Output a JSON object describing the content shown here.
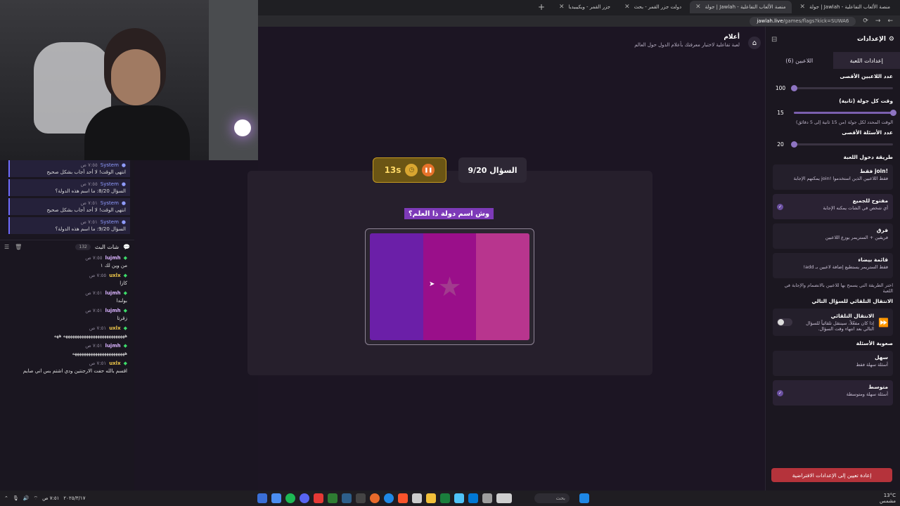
{
  "browser": {
    "tabs": [
      {
        "label": "جولة | Jawlah - منصة الألعاب التفاعلية",
        "active": false
      },
      {
        "label": "جولة | Jawlah - منصة الألعاب التفاعلية",
        "active": true
      },
      {
        "label": "دولت جزر القمر - بحث",
        "active": false
      },
      {
        "label": "جزر القمر - ويكيبيديا",
        "active": false
      }
    ],
    "url_domain": "jawlah.live",
    "url_path": "/games/flags?kick=SUWA6"
  },
  "chat": {
    "system_messages": [
      {
        "user": "System",
        "time": "٧:٥٥ ص",
        "text": "انتهى الوقت! لا أحد أجاب بشكل صحيح"
      },
      {
        "user": "System",
        "time": "٧:٥٥ ص",
        "text": "السؤال 8/20: ما اسم هذه الدولة؟"
      },
      {
        "user": "System",
        "time": "٧:٥١ ص",
        "text": "انتهى الوقت! لا أحد أجاب بشكل صحيح"
      },
      {
        "user": "System",
        "time": "٧:٥١ ص",
        "text": "السؤال 9/20: ما اسم هذه الدولة؟"
      }
    ],
    "header": {
      "title": "شات البث",
      "count": "132"
    },
    "messages": [
      {
        "user": "lujmh",
        "time": "٧:٥٥ ص",
        "text": "من وين لك ١",
        "color": "#d9b3ff"
      },
      {
        "user": "uxlx",
        "time": "٧:٥٥ ص",
        "text": "كازا",
        "color": "#f0c84a"
      },
      {
        "user": "lujmh",
        "time": "٧:٥١ ص",
        "text": "بولندا",
        "color": "#d9b3ff"
      },
      {
        "user": "lujmh",
        "time": "٧:٥١ ص",
        "text": "زقرتا",
        "color": "#d9b3ff"
      },
      {
        "user": "uxlx",
        "time": "٧:٥١ ص",
        "text": "هههههههههههههههههههههههههههه ههه",
        "color": "#f0c84a"
      },
      {
        "user": "lujmh",
        "time": "٧:٥١ ص",
        "text": "هههههههههههههههههههههههه",
        "color": "#d9b3ff"
      },
      {
        "user": "uxlx",
        "time": "٧:٥١ ص",
        "text": "اقسم بالله حفت الارجنتين ودي اشتم بس اني صايم",
        "color": "#f0c84a"
      }
    ]
  },
  "game": {
    "title": "أعلام",
    "subtitle": "لعبة تفاعلية لاختبار معرفتك بأعلام الدول حول العالم",
    "timer": "13s",
    "question_count": "السؤال 9/20",
    "question": "وش اسم دولة ذا العلم؟",
    "flag_colors": [
      "#6b1fa8",
      "#9a0f8a",
      "#b8358e"
    ],
    "flag_emblem": "star",
    "flag_emblem_color": "#a23b8e"
  },
  "settings": {
    "title": "الإعدادات",
    "tabs": [
      {
        "label": "إعدادات اللعبة",
        "active": true
      },
      {
        "label": "اللاعبين (6)",
        "active": false
      }
    ],
    "max_players": {
      "label": "عدد اللاعبين الأقصى",
      "value": "100",
      "fraction": 0
    },
    "round_time": {
      "label": "وقت كل جولة (ثانية)",
      "value": "15",
      "fraction": 1,
      "hint": "الوقت المحدد لكل جولة (من 15 ثانية إلى 5 دقائق)"
    },
    "max_questions": {
      "label": "عدد الأسئلة الأقصى",
      "value": "20",
      "fraction": 0
    },
    "entry_method_label": "طريقة دخول اللعبة",
    "entry_options": [
      {
        "name": "!join فقط",
        "desc": "فقط اللاعبين الذين استخدموا !join يمكنهم الإجابة",
        "selected": false
      },
      {
        "name": "مفتوح للجميع",
        "desc": "أي شخص في الشات يمكنه الإجابة",
        "selected": true
      },
      {
        "name": "فرق",
        "desc": "فريقين + الستريمر يوزع اللاعبين",
        "selected": false
      },
      {
        "name": "قائمة بيضاء",
        "desc": "فقط الستريمر يستطيع إضافة لاعبين بـ add!",
        "selected": false
      }
    ],
    "entry_hint": "اختر الطريقة التي يسمح بها للاعبين بالانضمام والإجابة في اللعبة",
    "auto_next_label": "الانتقال التلقائي للسؤال التالي",
    "auto_next": {
      "name": "الانتقال التلقائي",
      "desc": "إذا كان مفعّلاً، سينتقل تلقائياً للسؤال التالي بعد انتهاء وقت السؤال.",
      "enabled": false
    },
    "difficulty_label": "صعوبة الأسئلة",
    "difficulty_options": [
      {
        "name": "سهل",
        "desc": "أسئلة سهلة فقط",
        "selected": false
      },
      {
        "name": "متوسط",
        "desc": "أسئلة سهلة ومتوسطة",
        "selected": true
      }
    ],
    "reset_label": "إعادة تعيين إلى الإعدادات الافتراضية"
  },
  "taskbar": {
    "search_placeholder": "بحث",
    "weather": "13°C",
    "weather_desc": "مشمس",
    "clock_time": "٧:٥١ ص",
    "clock_date": "٢٠٢٥/٣/١٧"
  }
}
